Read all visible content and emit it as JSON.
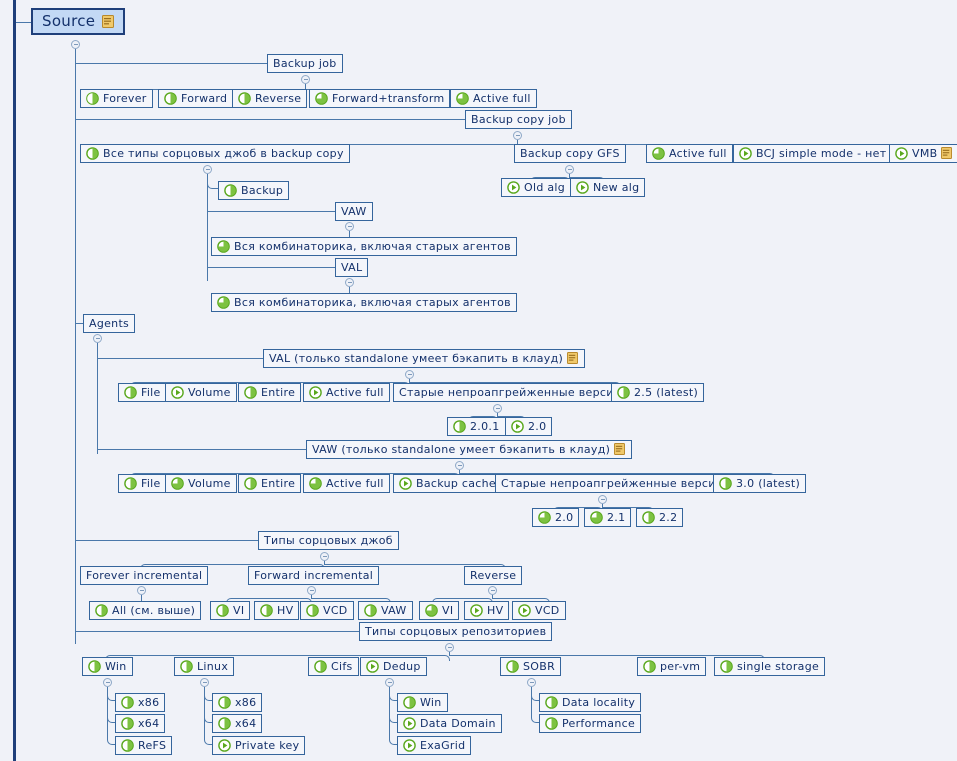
{
  "diagram": {
    "title": "Source",
    "type": "mindmap-tree",
    "icon_legend": {
      "half": "half-filled-circle-icon",
      "pie": "three-quarter-pie-icon",
      "play": "play-circle-icon",
      "note": "note-icon"
    },
    "colors": {
      "background": "#f0f2f8",
      "node_border": "#35659c",
      "node_text": "#14316b",
      "root_fill": "#c3d9f5",
      "connector": "#4a78aa",
      "icon_green": "#5aa81e",
      "note_yellow": "#e8b84b"
    }
  },
  "nodes": {
    "root": {
      "label": "Source",
      "icon": "none",
      "note": true
    },
    "backup_job": {
      "label": "Backup job",
      "icon": "none"
    },
    "bj_forever": {
      "label": "Forever",
      "icon": "half"
    },
    "bj_forward": {
      "label": "Forward",
      "icon": "half"
    },
    "bj_reverse": {
      "label": "Reverse",
      "icon": "half"
    },
    "bj_forward_transform": {
      "label": "Forward+transform",
      "icon": "pie"
    },
    "bj_active_full": {
      "label": "Active full",
      "icon": "pie"
    },
    "backup_copy_job": {
      "label": "Backup copy job",
      "icon": "none"
    },
    "bcj_all_types": {
      "label": "Все типы сорцовых джоб в backup copy",
      "icon": "half"
    },
    "bcj_gfs": {
      "label": "Backup copy GFS",
      "icon": "none"
    },
    "bcj_active_full": {
      "label": "Active full",
      "icon": "pie"
    },
    "bcj_simple_mode": {
      "label": "BCJ simple mode - нет",
      "icon": "play"
    },
    "bcj_vmb": {
      "label": "VMB",
      "icon": "play",
      "note": true
    },
    "gfs_old_alg": {
      "label": "Old alg",
      "icon": "play"
    },
    "gfs_new_alg": {
      "label": "New  alg",
      "icon": "play"
    },
    "bcj_backup": {
      "label": "Backup",
      "icon": "half"
    },
    "bcj_vaw": {
      "label": "VAW",
      "icon": "none"
    },
    "bcj_vaw_combo": {
      "label": "Вся комбинаторика, включая старых агентов",
      "icon": "pie"
    },
    "bcj_val": {
      "label": "VAL",
      "icon": "none"
    },
    "bcj_val_combo": {
      "label": "Вся комбинаторика, включая старых агентов",
      "icon": "pie"
    },
    "agents": {
      "label": "Agents",
      "icon": "none"
    },
    "val_header": {
      "label": "VAL (только standalone умеет бэкапить в клауд)",
      "icon": "none",
      "note": true
    },
    "val_file": {
      "label": "File",
      "icon": "half"
    },
    "val_volume": {
      "label": "Volume",
      "icon": "play"
    },
    "val_entire": {
      "label": "Entire",
      "icon": "half"
    },
    "val_active_full": {
      "label": "Active full",
      "icon": "play"
    },
    "val_old_versions": {
      "label": "Старые непроапгрейженные версии",
      "icon": "none"
    },
    "val_latest": {
      "label": "2.5 (latest)",
      "icon": "half"
    },
    "val_201": {
      "label": "2.0.1",
      "icon": "half"
    },
    "val_20": {
      "label": "2.0",
      "icon": "play"
    },
    "vaw_header": {
      "label": "VAW (только standalone умеет бэкапить в клауд)",
      "icon": "none",
      "note": true
    },
    "vaw_file": {
      "label": "File",
      "icon": "half"
    },
    "vaw_volume": {
      "label": "Volume",
      "icon": "pie"
    },
    "vaw_entire": {
      "label": "Entire",
      "icon": "half"
    },
    "vaw_active_full": {
      "label": "Active full",
      "icon": "pie"
    },
    "vaw_backup_cache": {
      "label": "Backup cache",
      "icon": "play"
    },
    "vaw_old_versions": {
      "label": "Старые непроапгрейженные версии",
      "icon": "none"
    },
    "vaw_latest": {
      "label": "3.0 (latest)",
      "icon": "half"
    },
    "vaw_20": {
      "label": "2.0",
      "icon": "pie"
    },
    "vaw_21": {
      "label": "2.1",
      "icon": "pie"
    },
    "vaw_22": {
      "label": "2.2",
      "icon": "half"
    },
    "job_types": {
      "label": "Типы сорцовых джоб",
      "icon": "none"
    },
    "jt_forever_incremental": {
      "label": "Forever incremental",
      "icon": "none"
    },
    "jt_forward_incremental": {
      "label": "Forward incremental",
      "icon": "none"
    },
    "jt_reverse": {
      "label": "Reverse",
      "icon": "none"
    },
    "jt_all": {
      "label": "All (см. выше)",
      "icon": "half"
    },
    "fi_vi": {
      "label": "VI",
      "icon": "half"
    },
    "fi_hv": {
      "label": "HV",
      "icon": "half"
    },
    "fi_vcd": {
      "label": "VCD",
      "icon": "half"
    },
    "fi_vaw": {
      "label": "VAW",
      "icon": "half"
    },
    "rv_vi": {
      "label": "VI",
      "icon": "pie"
    },
    "rv_hv": {
      "label": "HV",
      "icon": "play"
    },
    "rv_vcd": {
      "label": "VCD",
      "icon": "play"
    },
    "repo_types": {
      "label": "Типы сорцовых репозиториев",
      "icon": "none"
    },
    "repo_win": {
      "label": "Win",
      "icon": "half"
    },
    "repo_linux": {
      "label": "Linux",
      "icon": "half"
    },
    "repo_cifs": {
      "label": "Cifs",
      "icon": "half"
    },
    "repo_dedup": {
      "label": "Dedup",
      "icon": "play"
    },
    "repo_sobr": {
      "label": "SOBR",
      "icon": "half"
    },
    "repo_per_vm": {
      "label": "per-vm",
      "icon": "half"
    },
    "repo_single_storage": {
      "label": "single storage",
      "icon": "half"
    },
    "win_x86": {
      "label": "x86",
      "icon": "half"
    },
    "win_x64": {
      "label": "x64",
      "icon": "half"
    },
    "win_refs": {
      "label": "ReFS",
      "icon": "half"
    },
    "linux_x86": {
      "label": "x86",
      "icon": "half"
    },
    "linux_x64": {
      "label": "x64",
      "icon": "half"
    },
    "linux_private_key": {
      "label": "Private key",
      "icon": "play"
    },
    "dedup_win": {
      "label": "Win",
      "icon": "half"
    },
    "dedup_data_domain": {
      "label": "Data Domain",
      "icon": "play"
    },
    "dedup_exagrid": {
      "label": "ExaGrid",
      "icon": "play"
    },
    "sobr_data_locality": {
      "label": "Data locality",
      "icon": "half"
    },
    "sobr_performance": {
      "label": "Performance",
      "icon": "half"
    }
  }
}
